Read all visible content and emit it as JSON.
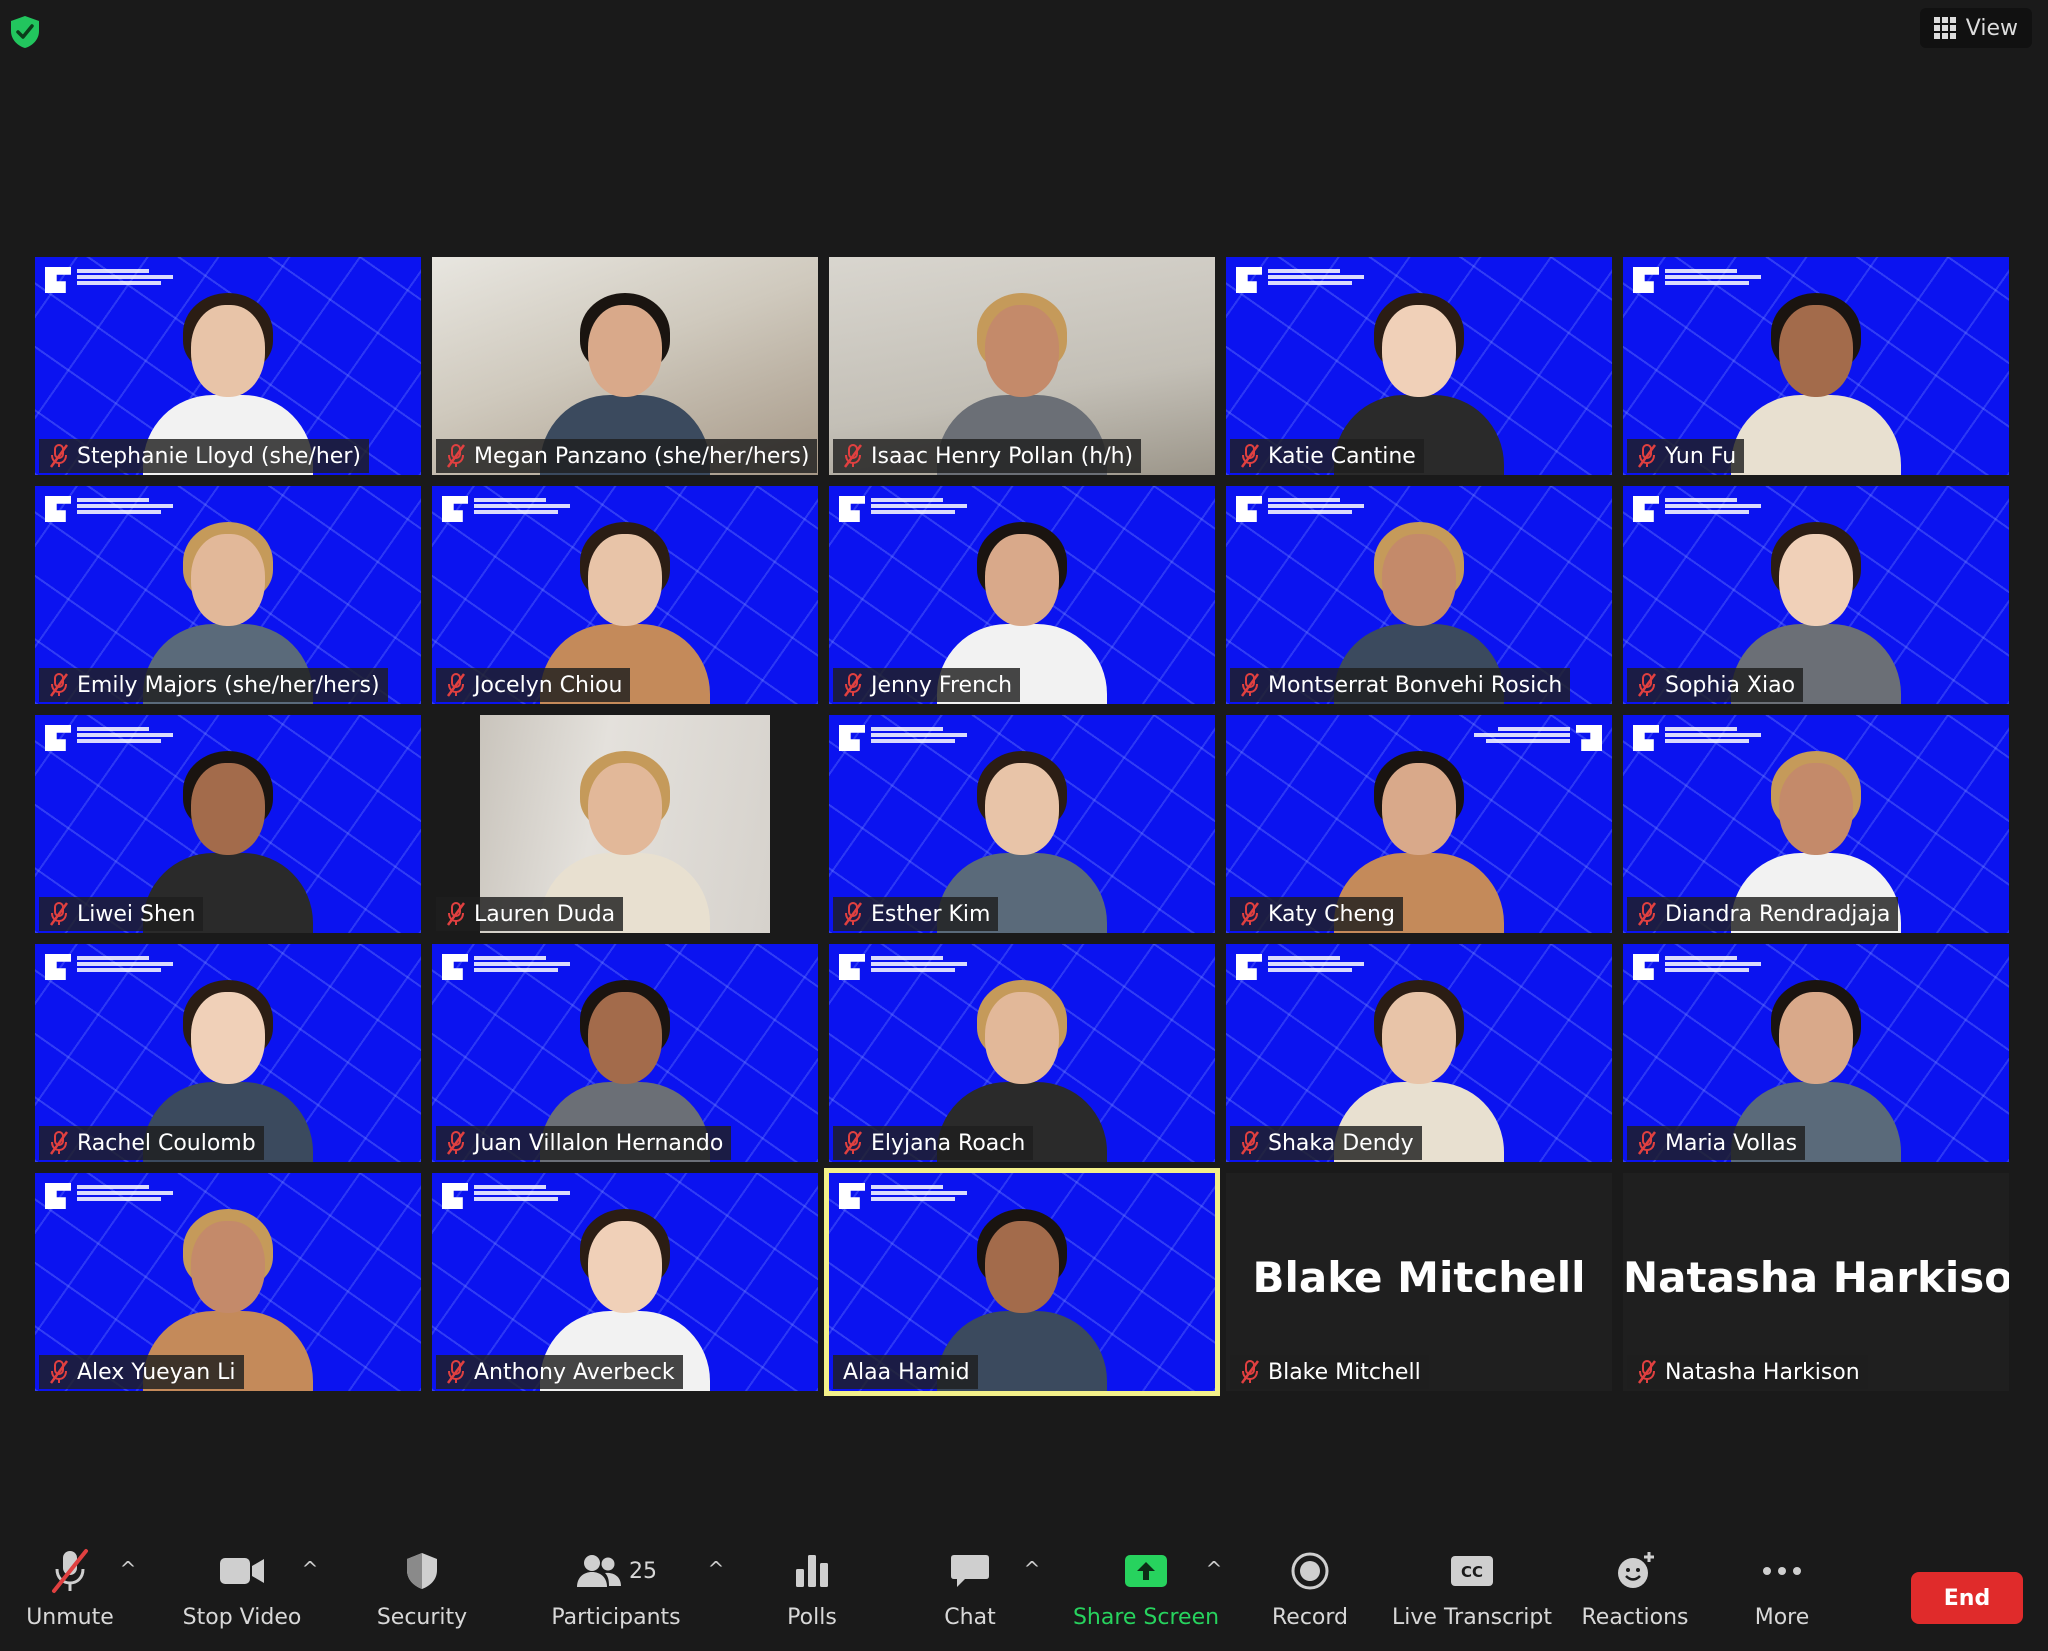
{
  "top": {
    "view_label": "View"
  },
  "participants": [
    {
      "name": "Stephanie Lloyd (she/her)",
      "bg": "blue",
      "muted": true
    },
    {
      "name": "Megan Panzano (she/her/hers)",
      "bg": "photo-shelf",
      "muted": true
    },
    {
      "name": "Isaac Henry Pollan (h/h)",
      "bg": "photo-room",
      "muted": true
    },
    {
      "name": "Katie Cantine",
      "bg": "blue",
      "muted": true
    },
    {
      "name": "Yun Fu",
      "bg": "blue",
      "muted": true
    },
    {
      "name": "Emily Majors (she/her/hers)",
      "bg": "blue",
      "muted": true
    },
    {
      "name": "Jocelyn Chiou",
      "bg": "blue",
      "muted": true
    },
    {
      "name": "Jenny French",
      "bg": "blue",
      "muted": true
    },
    {
      "name": "Montserrat Bonvehi Rosich",
      "bg": "blue",
      "muted": true
    },
    {
      "name": "Sophia Xiao",
      "bg": "blue",
      "muted": true
    },
    {
      "name": "Liwei Shen",
      "bg": "blue",
      "muted": true
    },
    {
      "name": "Lauren Duda",
      "bg": "photo-door",
      "muted": true
    },
    {
      "name": "Esther Kim",
      "bg": "blue",
      "muted": true
    },
    {
      "name": "Katy Cheng",
      "bg": "blue-mirror",
      "muted": true
    },
    {
      "name": "Diandra Rendradjaja",
      "bg": "blue",
      "muted": true
    },
    {
      "name": "Rachel Coulomb",
      "bg": "blue",
      "muted": true
    },
    {
      "name": "Juan Villalon Hernando",
      "bg": "blue",
      "muted": true
    },
    {
      "name": "Elyjana Roach",
      "bg": "blue",
      "muted": true
    },
    {
      "name": "Shaka Dendy",
      "bg": "blue",
      "muted": true
    },
    {
      "name": "Maria Vollas",
      "bg": "blue",
      "muted": true
    },
    {
      "name": "Alex Yueyan Li",
      "bg": "blue",
      "muted": true
    },
    {
      "name": "Anthony Averbeck",
      "bg": "blue",
      "muted": true
    },
    {
      "name": "Alaa Hamid",
      "bg": "blue",
      "muted": false,
      "active": true
    },
    {
      "name": "Blake Mitchell",
      "bg": "dark",
      "muted": true,
      "video_off": true
    },
    {
      "name": "Natasha Harkison",
      "bg": "dark",
      "muted": true,
      "video_off": true
    }
  ],
  "toolbar": {
    "unmute": "Unmute",
    "stop_video": "Stop Video",
    "security": "Security",
    "participants": "Participants",
    "participants_count": "25",
    "polls": "Polls",
    "chat": "Chat",
    "share_screen": "Share Screen",
    "record": "Record",
    "live_transcript": "Live Transcript",
    "reactions": "Reactions",
    "more": "More",
    "end": "End"
  },
  "colors": {
    "accent_green": "#27d35e",
    "end_red": "#e02b2b",
    "active_speaker": "#f3f08a",
    "tile_blue": "#0b13f0",
    "muted_red": "#e04040"
  }
}
